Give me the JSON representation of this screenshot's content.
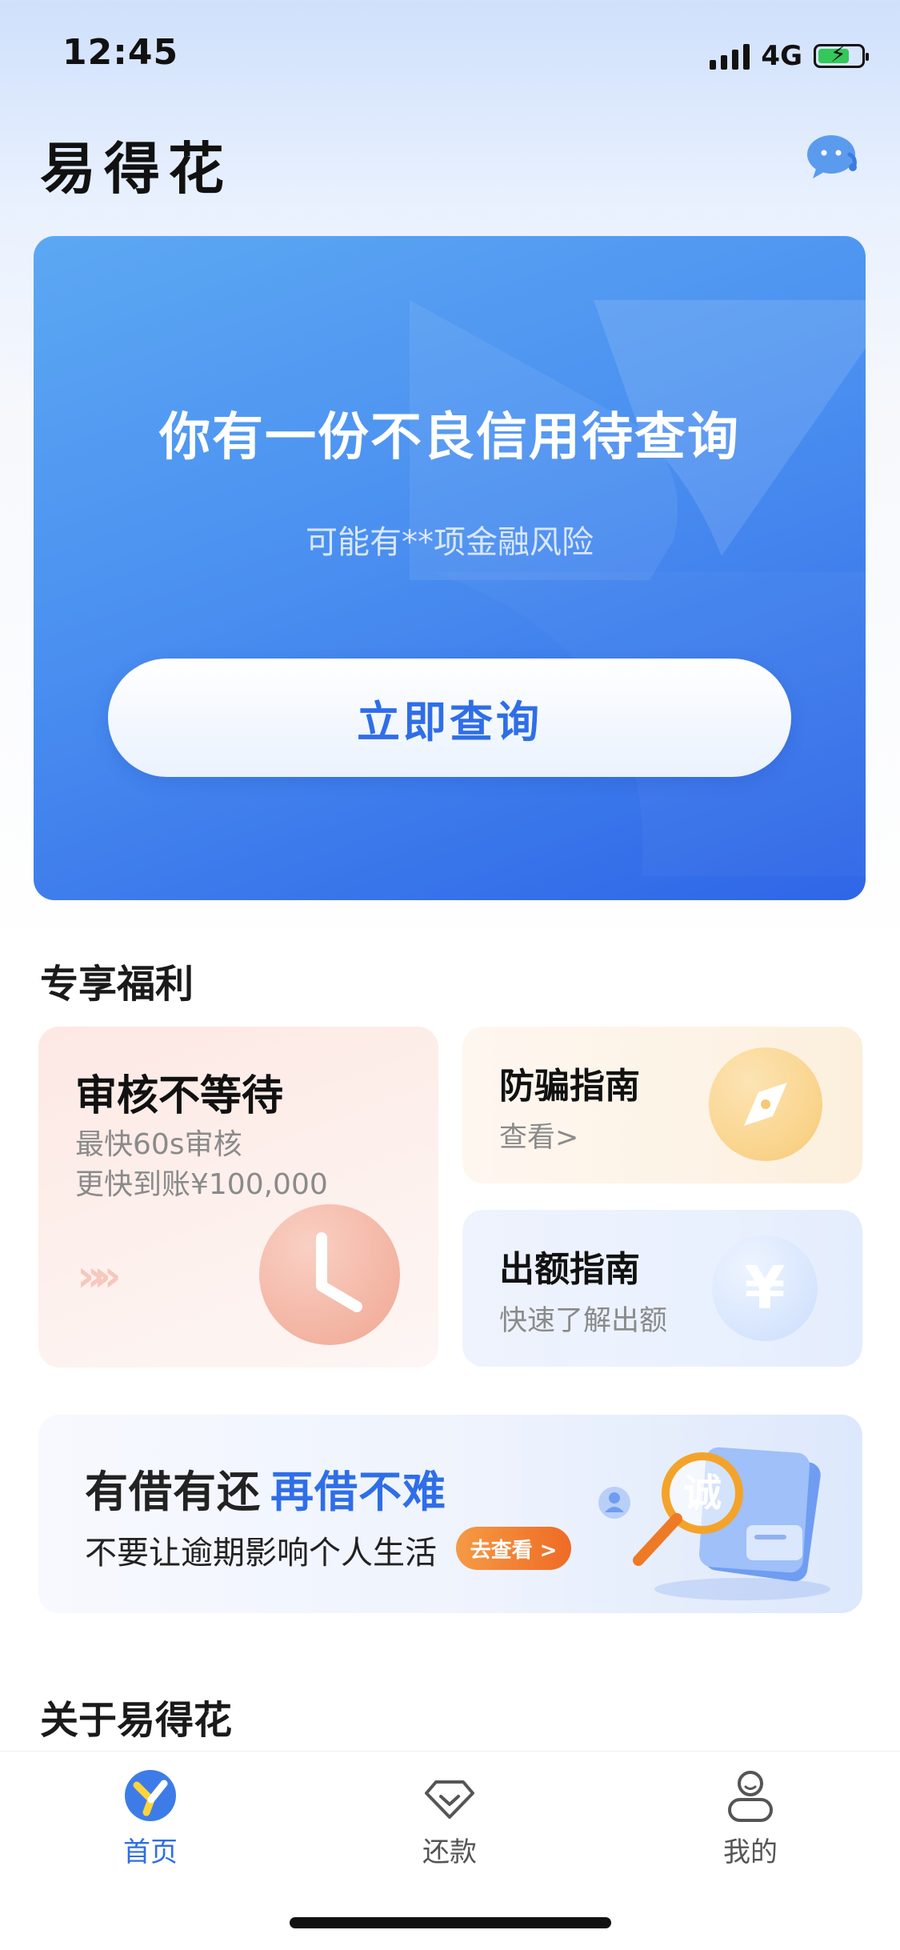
{
  "status_bar": {
    "time": "12:45",
    "network": "4G"
  },
  "header": {
    "app_title": "易得花"
  },
  "hero": {
    "headline": "你有一份不良信用待查询",
    "subtitle": "可能有**项金融风险",
    "button_label": "立即查询"
  },
  "benefits": {
    "section_title": "专享福利",
    "review_card": {
      "title": "审核不等待",
      "line1": "最快60s审核",
      "line2": "更快到账¥100,000",
      "arrows": "»»"
    },
    "fraud_card": {
      "title": "防骗指南",
      "subtitle": "查看>"
    },
    "amount_card": {
      "title": "出额指南",
      "subtitle": "快速了解出额",
      "icon_glyph": "¥"
    }
  },
  "promo": {
    "headline": "有借有还",
    "highlight": "再借不难",
    "subtitle": "不要让逾期影响个人生活",
    "button_label": "去查看 >",
    "art_glyph": "诚"
  },
  "about": {
    "section_title": "关于易得花"
  },
  "tabbar": {
    "items": [
      {
        "label": "首页",
        "icon": "home-logo-icon",
        "active": true
      },
      {
        "label": "还款",
        "icon": "diamond-icon",
        "active": false
      },
      {
        "label": "我的",
        "icon": "person-icon",
        "active": false
      }
    ]
  },
  "colors": {
    "accent": "#2f6ee8",
    "orange": "#ef6b25",
    "hero_start": "#5ca8f3",
    "hero_end": "#2f66e7"
  }
}
